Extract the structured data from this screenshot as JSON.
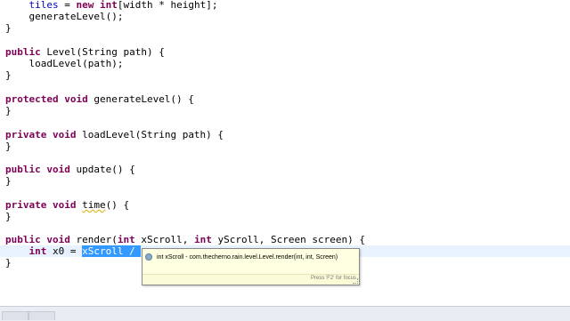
{
  "editor": {
    "lines": [
      {
        "pre": "    tiles = ",
        "kw": "new int",
        "post": "[width * height];"
      },
      {
        "text": "    generateLevel();"
      },
      {
        "text": "}"
      },
      {
        "kw": "public",
        "post": " Level(String path) {"
      },
      {
        "text": "    loadLevel(path);"
      },
      {
        "text": "}"
      },
      {
        "kw": "protected void",
        "post": " generateLevel() {"
      },
      {
        "text": "}"
      },
      {
        "kw": "private void",
        "post": " loadLevel(String path) {"
      },
      {
        "text": "}"
      },
      {
        "kw": "public void",
        "post": " update() {"
      },
      {
        "text": "}"
      },
      {
        "kw": "private void",
        "post": " time() {",
        "warn": "time"
      },
      {
        "text": "}"
      },
      {
        "kw": "public void",
        "post": " render(",
        "kw2": "int",
        "post2": " xScroll, ",
        "kw3": "int",
        "post3": " yScroll, Screen screen) {"
      },
      {
        "kw": "    int",
        "post": " x0 = ",
        "sel": "xScroll / "
      },
      {
        "text": "}"
      }
    ]
  },
  "popup": {
    "icon": "field-dot-icon",
    "proposal": "int xScroll - com.thecherno.rain.level.Level.render(int, int, Screen)",
    "hint": "Press 'F2' for focus"
  },
  "colors": {
    "keyword": "#7f0055",
    "field": "#0000c0",
    "selection": "#3399ff",
    "popup_bg": "#ffffe1"
  }
}
